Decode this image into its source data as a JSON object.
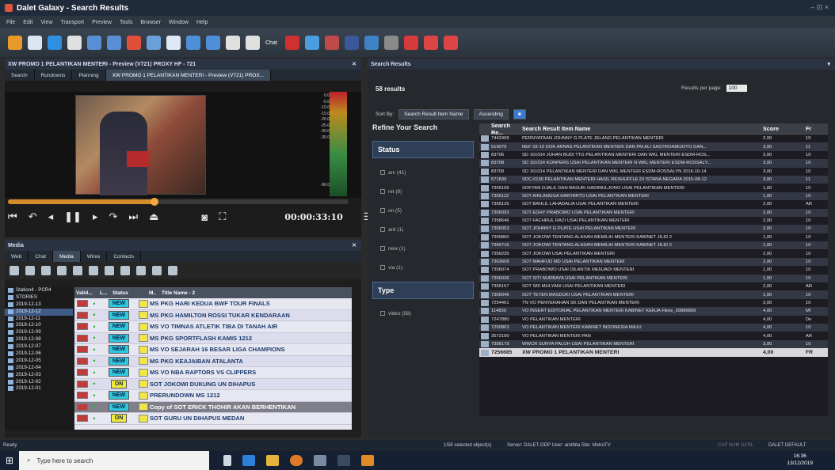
{
  "window": {
    "title": "Dalet Galaxy - Search Results",
    "controls": "– ⊡ ×"
  },
  "menu": [
    "File",
    "Edit",
    "View",
    "Transport",
    "Preview",
    "Tools",
    "Browser",
    "Window",
    "Help"
  ],
  "toolbar": {
    "chat_label": "Chat",
    "colors": [
      "#e79a2a",
      "#dbe6f3",
      "#2f8fe0",
      "#e0e0e0",
      "#5a8fd6",
      "#5a8fd6",
      "#e04f3a",
      "#6aa0d8",
      "#dfe8f5",
      "#4f8fd9",
      "#4f8fd9",
      "#e0e0e0",
      "#e0e0e0",
      "#d03030",
      "#4a9ee0",
      "#c04a4a",
      "#3b5998",
      "#3d82c4",
      "#8a8a8a",
      "#d63a3a",
      "#d44",
      "#d44"
    ]
  },
  "preview_panel": {
    "title": "XW PROMO 1 PELANTIKAN MENTERI - Preview (V721) PROXY HF - 721",
    "tabs": [
      "Search",
      "Rundowns",
      "Planning",
      "XW PROMO 1 PELANTIKAN MENTERI - Preview (V721) PROX..."
    ],
    "meter_labels": [
      "0.0",
      "-5.0",
      "-10.0",
      "-15.0",
      "-20.0",
      "-25.0",
      "-30.0",
      "-35.0",
      "",
      "",
      "",
      "",
      "",
      "",
      "",
      "-96.0"
    ],
    "progress_fraction": 0.43,
    "timecode": "00:00:33:10"
  },
  "media_panel": {
    "title": "Media",
    "tabs": [
      "Web",
      "Chat",
      "Media",
      "Wires",
      "Contacts"
    ],
    "tree": [
      {
        "label": "Station4 - PCR4",
        "selected": false
      },
      {
        "label": "STORIES",
        "selected": false
      },
      {
        "label": "2019-12-13",
        "selected": false
      },
      {
        "label": "2019-12-12",
        "selected": true
      },
      {
        "label": "2019-12-11",
        "selected": false
      },
      {
        "label": "2019-12-10",
        "selected": false
      },
      {
        "label": "2019-12-09",
        "selected": false
      },
      {
        "label": "2019-12-08",
        "selected": false
      },
      {
        "label": "2019-12-07",
        "selected": false
      },
      {
        "label": "2019-12-06",
        "selected": false
      },
      {
        "label": "2019-12-05",
        "selected": false
      },
      {
        "label": "2019-12-04",
        "selected": false
      },
      {
        "label": "2019-12-03",
        "selected": false
      },
      {
        "label": "2019-12-02",
        "selected": false
      },
      {
        "label": "2019-12-01",
        "selected": false
      }
    ],
    "columns": [
      "Valid...",
      "L...",
      "Status",
      "M..",
      "Title Name  - 2"
    ],
    "rows": [
      {
        "status": "NEW",
        "title": "MS PKG HARI KEDUA BWF TOUR FINALS",
        "selected": false
      },
      {
        "status": "NEW",
        "title": "MS PKG HAMILTON ROSSI TUKAR KENDARAAN",
        "selected": false
      },
      {
        "status": "NEW",
        "title": "MS VO TIMNAS ATLETIK TIBA DI TANAH AIR",
        "selected": false
      },
      {
        "status": "NEW",
        "title": "MS PKG SPORTFLASH KAMIS 1212",
        "selected": false
      },
      {
        "status": "NEW",
        "title": "MS VO SEJARAH 16 BESAR LIGA CHAMPIONS",
        "selected": false
      },
      {
        "status": "NEW",
        "title": "MS PKG KEAJAIBAN ATALANTA",
        "selected": false
      },
      {
        "status": "NEW",
        "title": "MS VO NBA RAPTORS VS CLIPPERS",
        "selected": false
      },
      {
        "status": "ON",
        "title": "SOT JOKOWI DUKUNG UN DIHAPUS",
        "selected": false
      },
      {
        "status": "NEW",
        "title": "PRERUNDOWN MS 1212",
        "selected": false
      },
      {
        "status": "NEW",
        "title": "Copy of SOT ERICK THOHIR AKAN BERHENTIKAN",
        "selected": true
      },
      {
        "status": "ON",
        "title": "SOT GURU UN DIHAPUS MEDAN",
        "selected": false
      }
    ],
    "status_colors": {
      "NEW": "#30c7e0",
      "ON": "#f0ea3a"
    }
  },
  "search_results": {
    "tab_label": "Search Results",
    "count": "58 results",
    "per_page_label": "Results per page:",
    "per_page_value": "100",
    "sort_label": "Sort By:",
    "sort_field": "Search Result Item Name",
    "sort_order": "Ascending",
    "refine_title": "Refine Your Search",
    "status_group": "Status",
    "status_facets": [
      "arc (41)",
      "ret (9)",
      "on (5)",
      "ard (1)",
      "new (1)",
      "via (1)"
    ],
    "type_group": "Type",
    "type_facets": [
      "video (58)"
    ],
    "columns": [
      "Search Re...",
      "Search Result Item Name",
      "Score",
      "Fr"
    ],
    "rows": [
      {
        "id": "7442469",
        "name": "PERNYATAAN JOHNNY G PLATE JELANG PELANTIKAN MENTERI",
        "score": "2,00",
        "f": "10"
      },
      {
        "id": "519079",
        "name": "REF 03-10 DOK ARNAS PELANTIKAN MENTERI DAN PM ALI SASTROAMIJOYO DAN...",
        "score": "3,00",
        "f": "11"
      },
      {
        "id": "83706",
        "name": "SD 161014 JOHAN BUDI TTG PELANTIKAN MENTERI DAN WKL MENTERI ESDM-ROS...",
        "score": "3,00",
        "f": "10"
      },
      {
        "id": "83708",
        "name": "SD 161014 KONPERS USAI PELANTIKAN MENTERI N WKL MENTERI ESDM-ROSSALY...",
        "score": "3,00",
        "f": "10"
      },
      {
        "id": "83709",
        "name": "SD 161014 PELANTIKAN MENTERI DAN WKL MENTERI ESDM-ROSSALYN 2016-10-14",
        "score": "3,00",
        "f": "10"
      },
      {
        "id": "571839",
        "name": "SDC-0130 PELANTIKAN MENTERI HASIL RESHUFFLE DI ISTANA NEGARA 2015-08-12",
        "score": "3,00",
        "f": "11"
      },
      {
        "id": "7356106",
        "name": "SOFYAN DJALIL DAN BASUKI HADIMULJONO USAI PELANTIKAN MENTERI",
        "score": "1,00",
        "f": "10"
      },
      {
        "id": "7356112",
        "name": "SOT AIRLANGGA HARTARTO USAI PELANTIKAN MENTERI",
        "score": "1,00",
        "f": "10"
      },
      {
        "id": "7356126",
        "name": "SOT BAHLIL LAHADALIA USAI PELANTIKAN MENTERI",
        "score": "2,00",
        "f": "AR"
      },
      {
        "id": "7356093",
        "name": "SOT EDHY PRABOWO USAI PELANTIKAN MENTERI",
        "score": "2,00",
        "f": "10"
      },
      {
        "id": "7358646",
        "name": "SOT FACHRUL RAZI USAI PELANTIKAN MENTERI",
        "score": "2,00",
        "f": "10"
      },
      {
        "id": "7356053",
        "name": "SOT JOHNNY G PLATE USAI PELANTIKAN MENTERI",
        "score": "2,00",
        "f": "10"
      },
      {
        "id": "7366860",
        "name": "SOT JOKOWI TENTANG ALASAN MEMILIH MENTERI KABINET JILID 2",
        "score": "1,00",
        "f": "10"
      },
      {
        "id": "7366716",
        "name": "SOT JOKOWI TENTANG ALASAN MEMILIH MENTERI KABINET JILID 2",
        "score": "1,00",
        "f": "10"
      },
      {
        "id": "7356235",
        "name": "SOT JOKOWI USAI PELANTIKAN MENTERI",
        "score": "2,00",
        "f": "10"
      },
      {
        "id": "7363608",
        "name": "SOT MAHFUD MD USAI PELANTIKAN MENTERI",
        "score": "2,00",
        "f": "10"
      },
      {
        "id": "7356074",
        "name": "SOT PRABOWO USAI DILANTIK MENJADI MENTERI",
        "score": "1,00",
        "f": "10"
      },
      {
        "id": "7356036",
        "name": "SOT SITI NURBAYA USAI PELANTIKAN MENTERI",
        "score": "1,00",
        "f": "10"
      },
      {
        "id": "7356167",
        "name": "SOT SRI MULYANI USAI PELANTIKAN MENTERI",
        "score": "2,00",
        "f": "AR"
      },
      {
        "id": "7356046",
        "name": "SOT TETEN MASDUKI USAI PELANTIKAN MENTERI",
        "score": "1,00",
        "f": "10"
      },
      {
        "id": "7254461",
        "name": "TN VO PENYERAHAN SK DAN PELANTIKAN MENTERI",
        "score": "3,00",
        "f": "10"
      },
      {
        "id": "114830",
        "name": "VO INSERT EDITORIAL PELANTIKAN MENTERI KABINET KERJA Fikrie_20986809",
        "score": "4,00",
        "f": "MI"
      },
      {
        "id": "7247880",
        "name": "VO PELANTIKAN MENTERI",
        "score": "4,00",
        "f": "De"
      },
      {
        "id": "7250863",
        "name": "VO PELANTIKAN MENTERI KABINET INDONESIA MAJU",
        "score": "4,00",
        "f": "10"
      },
      {
        "id": "3572100",
        "name": "VO PELANTIKAN MENTERI PAN",
        "score": "4,00",
        "f": "AR"
      },
      {
        "id": "7356179",
        "name": "WWCR SURYA PALOH USAI PELANTIKAN MENTERI",
        "score": "3,00",
        "f": "10"
      },
      {
        "id": "7256685",
        "name": "XW PROMO 1 PELANTIKAN MENTERI",
        "score": "4,00",
        "f": "FR"
      }
    ]
  },
  "statusbar": {
    "left": "Ready",
    "selected": "1/58 selected object(s)",
    "server": "Server: DALET-ODP User: andhita Site: MetroTV",
    "caps": "CAP NUM SCRL",
    "profile": "DALET DEFAULT"
  },
  "taskbar": {
    "search_placeholder": "Type here to search",
    "time": "16:36",
    "date": "13/12/2019"
  }
}
